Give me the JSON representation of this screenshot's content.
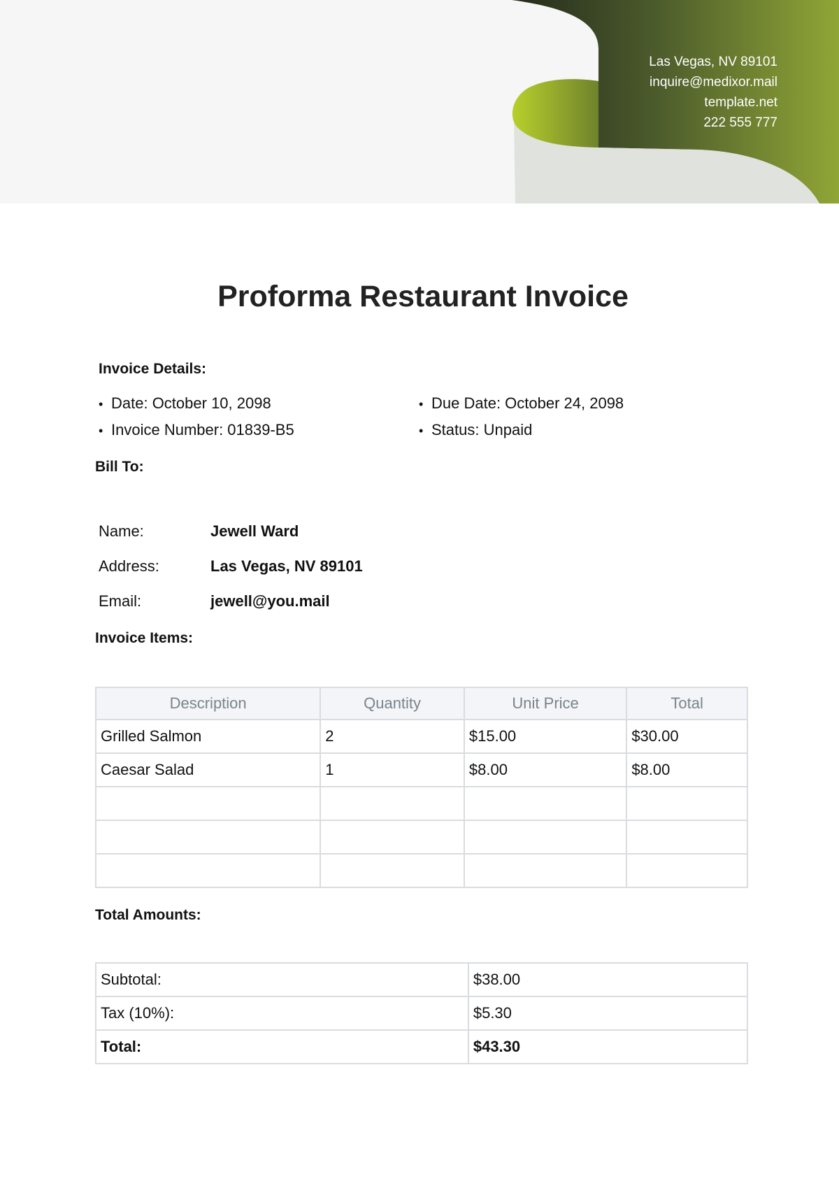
{
  "header": {
    "contact": {
      "address": "Las Vegas, NV 89101",
      "email": "inquire@medixor.mail",
      "website": "template.net",
      "phone": "222 555 777"
    },
    "colors": {
      "band_bg": "#f6f6f6",
      "dark_green": "#2f3a22",
      "olive_green": "#8ea332",
      "lime_green": "#b5cc2d",
      "curl_gray": "#dfe2dd"
    }
  },
  "title": "Proforma Restaurant Invoice",
  "invoice_details": {
    "heading": "Invoice Details:",
    "date": "Date: October 10, 2098",
    "invoice_number": "Invoice Number: 01839-B5",
    "due_date": "Due Date: October 24, 2098",
    "status": "Status: Unpaid"
  },
  "bill_to": {
    "heading": "Bill To:",
    "name_label": "Name:",
    "name_value": "Jewell Ward",
    "address_label": "Address:",
    "address_value": "Las Vegas, NV 89101",
    "email_label": "Email:",
    "email_value": "jewell@you.mail"
  },
  "items": {
    "heading": "Invoice Items:",
    "columns": [
      "Description",
      "Quantity",
      "Unit Price",
      "Total"
    ],
    "rows": [
      [
        "Grilled Salmon",
        "2",
        "$15.00",
        "$30.00"
      ],
      [
        "Caesar Salad",
        "1",
        "$8.00",
        "$8.00"
      ],
      [
        "",
        "",
        "",
        ""
      ],
      [
        "",
        "",
        "",
        ""
      ],
      [
        "",
        "",
        "",
        ""
      ]
    ]
  },
  "totals": {
    "heading": "Total Amounts:",
    "subtotal_label": "Subtotal:",
    "subtotal_value": "$38.00",
    "tax_label": "Tax (10%):",
    "tax_value": "$5.30",
    "total_label": "Total:",
    "total_value": "$43.30"
  }
}
